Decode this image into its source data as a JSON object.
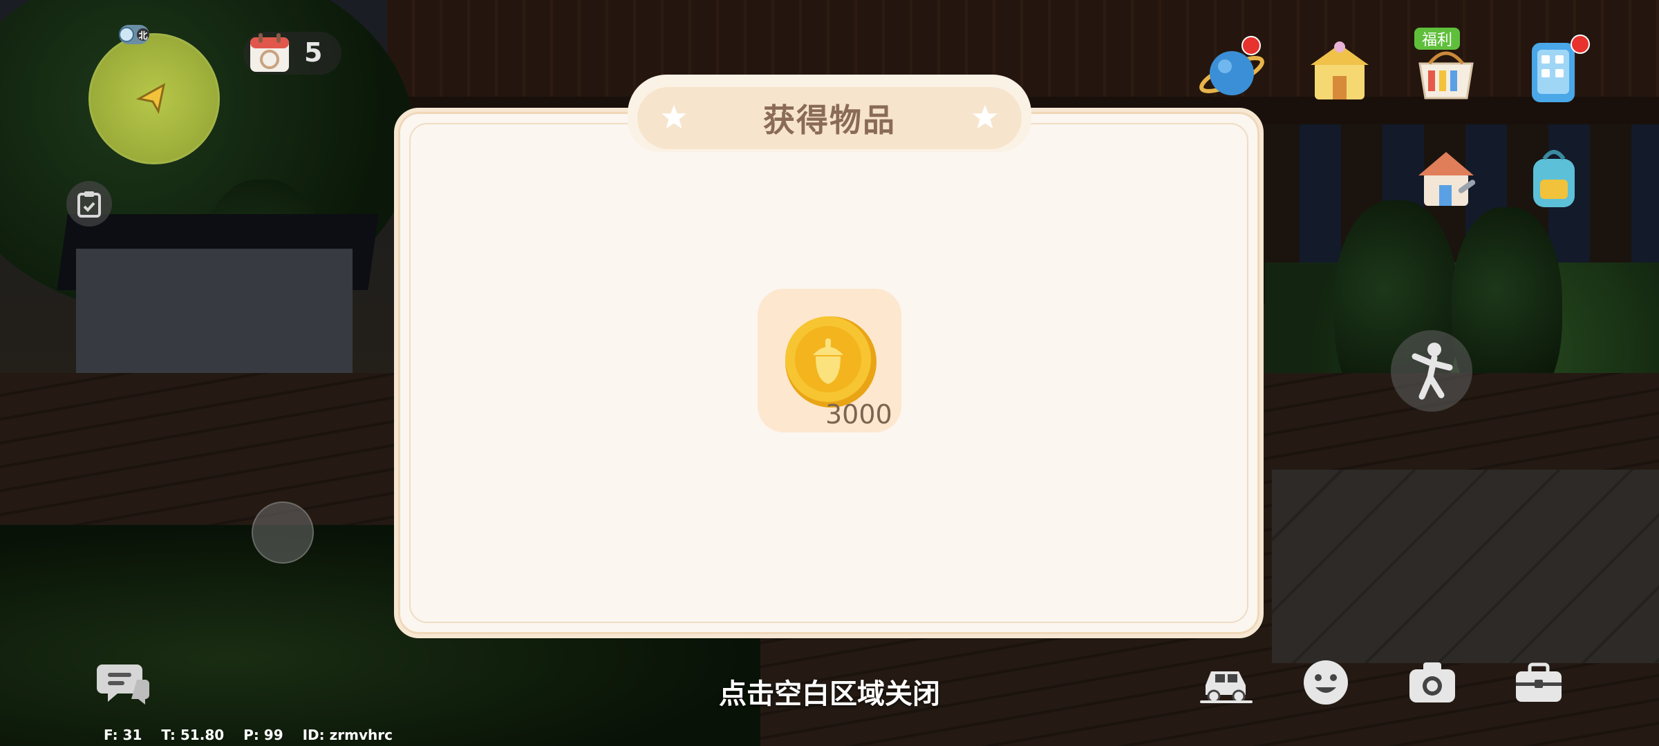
{
  "hud": {
    "compass_label": "北",
    "calendar_count": "5",
    "welfare_tag": "福利"
  },
  "modal": {
    "title": "获得物品",
    "item": {
      "icon": "acorn-coin-icon",
      "quantity": "3000"
    }
  },
  "close_hint": "点击空白区域关闭",
  "debug": {
    "fps": "F: 31",
    "time": "T: 51.80",
    "ping": "P: 99",
    "id": "ID: zrmvhrc"
  },
  "colors": {
    "modal_bg": "#fbf6f0",
    "title_pill": "#f7e4cc",
    "title_text": "#8a6b58",
    "coin": "#f2b51c",
    "reddot": "#e8322e",
    "welfare_tag": "#5fbf3b"
  }
}
